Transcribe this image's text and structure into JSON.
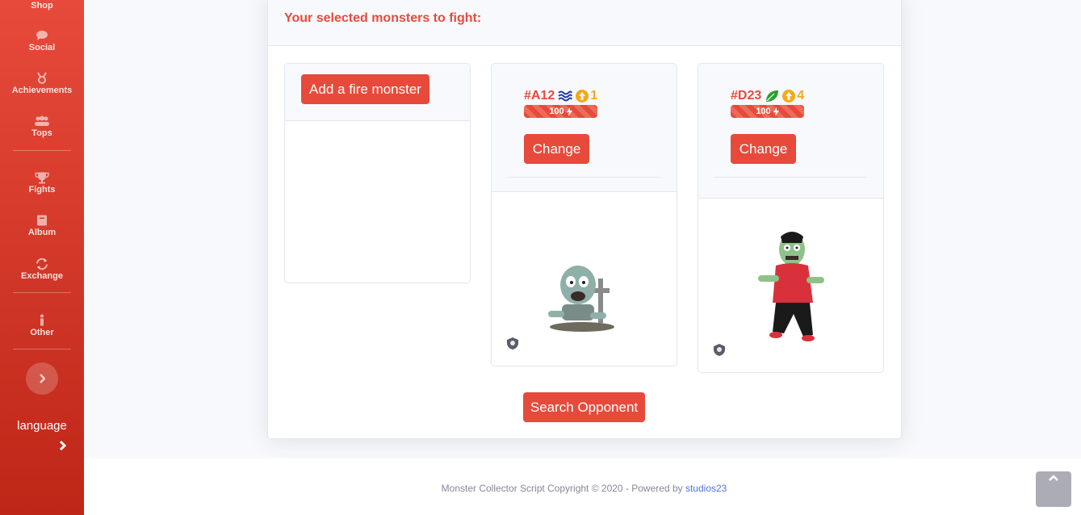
{
  "sidebar": {
    "items": [
      {
        "label": "Shop",
        "icon": "shop-icon"
      },
      {
        "label": "Social",
        "icon": "comment-icon"
      },
      {
        "label": "Achievements",
        "icon": "medal-icon"
      },
      {
        "label": "Tops",
        "icon": "users-icon"
      },
      {
        "label": "Fights",
        "icon": "trophy-icon"
      },
      {
        "label": "Album",
        "icon": "book-icon"
      },
      {
        "label": "Exchange",
        "icon": "sync-icon"
      },
      {
        "label": "Other",
        "icon": "info-icon"
      }
    ],
    "language_label": "language",
    "toggle_icon": "chevron-right-icon"
  },
  "main": {
    "title": "Your selected monsters to fight:",
    "slot1": {
      "button_label": "Add a fire monster"
    },
    "slot2": {
      "id": "#A12",
      "element_icon": "water-icon",
      "level": "1",
      "energy": "100",
      "button_label": "Change"
    },
    "slot3": {
      "id": "#D23",
      "element_icon": "leaf-icon",
      "level": "4",
      "energy": "100",
      "button_label": "Change"
    },
    "search_button": "Search Opponent"
  },
  "footer": {
    "text": "Monster Collector Script Copyright © 2020 - Powered by",
    "link": "studios23"
  },
  "colors": {
    "primary": "#e74a3b",
    "level": "#f6a818",
    "water": "#1e3fa8",
    "leaf": "#2e9e2e"
  }
}
